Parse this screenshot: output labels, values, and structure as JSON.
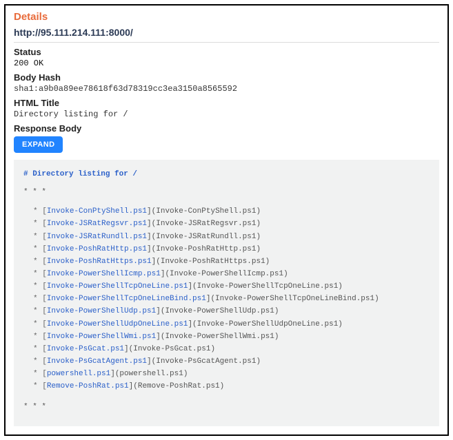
{
  "details": {
    "title": "Details",
    "url": "http://95.111.214.111:8000/",
    "status_label": "Status",
    "status_value": "200 OK",
    "body_hash_label": "Body Hash",
    "body_hash_value": "sha1:a9b0a89ee78618f63d78319cc3ea3150a8565592",
    "html_title_label": "HTML Title",
    "html_title_value": "Directory listing for /",
    "response_body_label": "Response Body",
    "expand_label": "EXPAND"
  },
  "listing": {
    "heading": "# Directory listing for /",
    "sep": "* * *",
    "items": [
      "Invoke-ConPtyShell.ps1",
      "Invoke-JSRatRegsvr.ps1",
      "Invoke-JSRatRundll.ps1",
      "Invoke-PoshRatHttp.ps1",
      "Invoke-PoshRatHttps.ps1",
      "Invoke-PowerShellIcmp.ps1",
      "Invoke-PowerShellTcpOneLine.ps1",
      "Invoke-PowerShellTcpOneLineBind.ps1",
      "Invoke-PowerShellUdp.ps1",
      "Invoke-PowerShellUdpOneLine.ps1",
      "Invoke-PowerShellWmi.ps1",
      "Invoke-PsGcat.ps1",
      "Invoke-PsGcatAgent.ps1",
      "powershell.ps1",
      "Remove-PoshRat.ps1"
    ]
  }
}
